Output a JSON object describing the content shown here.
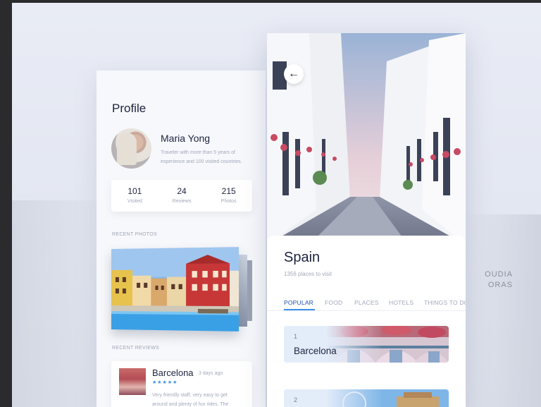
{
  "profile": {
    "title": "Profile",
    "name": "Maria Yong",
    "bio": "Traveler with more than 5 years of experience and 100 visited countries.",
    "stats": [
      {
        "value": "101",
        "label": "Visited"
      },
      {
        "value": "24",
        "label": "Reviews"
      },
      {
        "value": "215",
        "label": "Photos"
      }
    ],
    "recent_photos_label": "RECENT PHOTOS",
    "recent_reviews_label": "RECENT REVIEWS",
    "review": {
      "place": "Barcelona",
      "date": "3 days ago",
      "stars": "★★★★★",
      "rating": 4.5,
      "text": "Very friendly staff, very easy to get around and plenty of fun rides. The"
    }
  },
  "destination": {
    "back_icon": "←",
    "country": "Spain",
    "places_count": "1356 places to visit",
    "tabs": [
      "POPULAR",
      "FOOD",
      "PLACES",
      "HOTELS",
      "THINGS TO DO"
    ],
    "active_tab": "POPULAR",
    "places": [
      {
        "rank": "1",
        "name": "Barcelona"
      },
      {
        "rank": "2",
        "name": ""
      }
    ]
  },
  "background": {
    "sign_lines": [
      "OUDIA",
      "ORAS"
    ]
  },
  "colors": {
    "accent": "#3b8ee8",
    "text_dark": "#1d2340",
    "text_muted": "#a2a8bb",
    "card_bg": "#ffffff"
  }
}
